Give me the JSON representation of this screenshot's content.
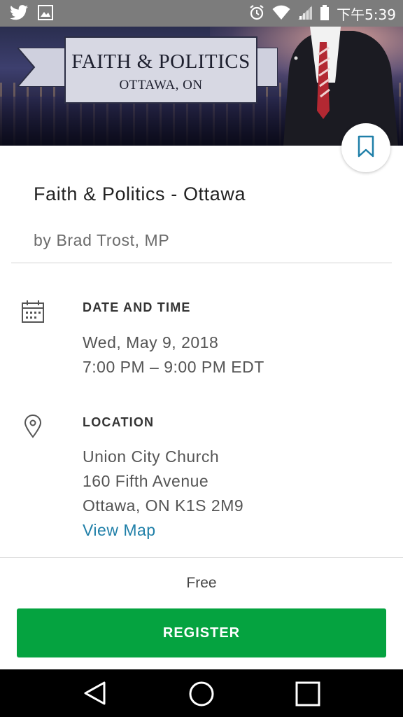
{
  "status_bar": {
    "time": "下午5:39",
    "left_icons": [
      "twitter-icon",
      "image-icon"
    ],
    "right_icons": [
      "alarm-icon",
      "wifi-icon",
      "signal-icon",
      "battery-icon"
    ]
  },
  "banner": {
    "title_line1": "FAITH & POLITICS",
    "title_line2": "OTTAWA, ON"
  },
  "event": {
    "title": "Faith & Politics - Ottawa",
    "organizer": "by Brad Trost, MP"
  },
  "date_section": {
    "icon": "calendar-icon",
    "heading": "DATE AND TIME",
    "date": "Wed, May 9, 2018",
    "time": "7:00 PM – 9:00 PM EDT"
  },
  "location_section": {
    "icon": "location-pin-icon",
    "heading": "LOCATION",
    "venue": "Union City Church",
    "address1": "160 Fifth Avenue",
    "address2": "Ottawa, ON K1S 2M9",
    "map_link": "View Map"
  },
  "footer": {
    "price": "Free",
    "register_label": "REGISTER"
  },
  "colors": {
    "accent_link": "#1f7fa8",
    "register_green": "#05a340",
    "status_bar": "#7c7c7c"
  },
  "nav_icons": [
    "back-icon",
    "home-icon",
    "recents-icon"
  ]
}
